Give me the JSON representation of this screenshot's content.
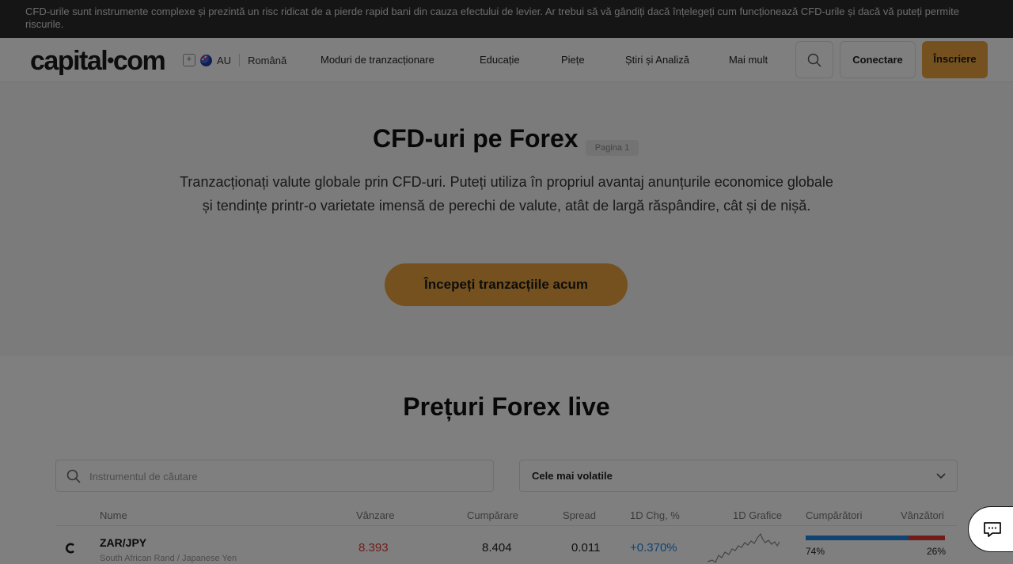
{
  "risk_banner": "CFD-urile sunt instrumente complexe și prezintă un risc ridicat de a pierde rapid bani din cauza efectului de levier. Ar trebui să vă gândiți dacă înțelegeți cum funcționează CFD-urile și dacă vă puteți permite riscurile.",
  "header": {
    "logo_main": "capital",
    "logo_dot": "•",
    "logo_tail": "com",
    "region": "AU",
    "language": "Română",
    "nav": [
      "Moduri de tranzacționare",
      "Educație",
      "Piețe",
      "Știri și Analiză",
      "Mai mult"
    ],
    "login": "Conectare",
    "signup": "Înscriere"
  },
  "hero": {
    "title": "CFD-uri pe Forex",
    "page_badge": "Pagina 1",
    "description": "Tranzacționați valute globale prin CFD-uri. Puteți utiliza în propriul avantaj anunțurile economice globale și tendințe printr-o varietate imensă de perechi de valute, atât de largă răspândire, cât și de nișă.",
    "cta": "Începeți tranzacțiile acum"
  },
  "prices": {
    "title": "Prețuri Forex live",
    "search_placeholder": "Instrumentul de căutare",
    "sort_selected": "Cele mai volatile",
    "columns": [
      "Nume",
      "Vânzare",
      "Cumpărare",
      "Spread",
      "1D Chg, %",
      "1D Grafice",
      "Cumpărători",
      "Vânzători"
    ],
    "rows": [
      {
        "symbol": "ZAR/JPY",
        "name": "South African Rand / Japanese Yen",
        "sell": "8.393",
        "buy": "8.404",
        "spread": "0.011",
        "change": "+0.370%",
        "buyers_pct": "74%",
        "sellers_pct": "26%",
        "buyers_fraction": 0.74
      }
    ]
  },
  "colors": {
    "accent": "#e8a33c",
    "sell": "#e53935",
    "change_up": "#1e88e5",
    "buyers_bar": "#1e88e5",
    "sellers_bar": "#e53935"
  }
}
